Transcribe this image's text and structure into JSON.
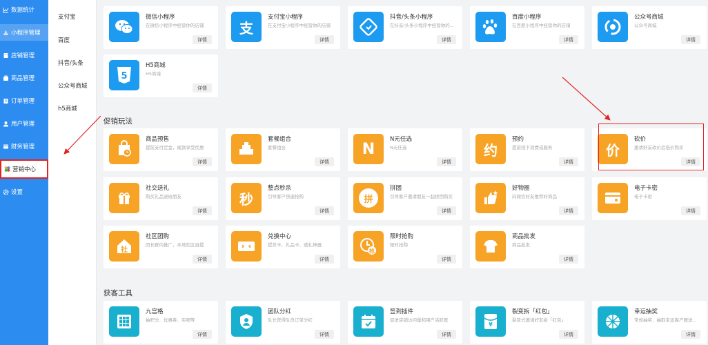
{
  "sidebar": {
    "items": [
      {
        "label": "数据统计",
        "icon": "chart-icon"
      },
      {
        "label": "小程序管理",
        "icon": "link-icon"
      },
      {
        "label": "店铺管理",
        "icon": "store-icon"
      },
      {
        "label": "商品管理",
        "icon": "goods-icon"
      },
      {
        "label": "订单管理",
        "icon": "order-icon"
      },
      {
        "label": "用户管理",
        "icon": "user-icon"
      },
      {
        "label": "财务管理",
        "icon": "finance-icon"
      },
      {
        "label": "营销中心",
        "icon": "marketing-icon"
      },
      {
        "label": "设置",
        "icon": "gear-icon"
      }
    ]
  },
  "submenu": {
    "items": [
      "支付宝",
      "百度",
      "抖音/头条",
      "公众号商城",
      "h5商城"
    ]
  },
  "sections": {
    "promo": "促销玩法",
    "acquire": "获客工具"
  },
  "button_label": "详情",
  "platform_cards": [
    {
      "title": "微信小程序",
      "desc": "在微信小程序中经营你的店铺",
      "icon": "wechat-icon"
    },
    {
      "title": "支付宝小程序",
      "desc": "在支付宝小程序中经营你的店铺",
      "icon": "alipay-icon",
      "glyph": "支"
    },
    {
      "title": "抖音/头条小程序",
      "desc": "在抖音/头条小程序中经营你的...",
      "icon": "tiktok-icon"
    },
    {
      "title": "百度小程序",
      "desc": "在百度小程序中经营你的店铺",
      "icon": "baidu-icon"
    },
    {
      "title": "公众号商城",
      "desc": "公众号商城",
      "icon": "official-account-icon"
    },
    {
      "title": "H5商城",
      "desc": "H5商城",
      "icon": "html5-icon",
      "glyph": "5"
    }
  ],
  "promo_cards": [
    {
      "title": "商品预售",
      "desc": "提前支付定金，尾款享受优惠",
      "icon": "presale-icon"
    },
    {
      "title": "套餐组合",
      "desc": "套餐组合",
      "icon": "combo-icon"
    },
    {
      "title": "N元任选",
      "desc": "N元任选",
      "icon": "n-yuan-icon",
      "glyph": "N"
    },
    {
      "title": "预约",
      "desc": "提前线下消费或服务",
      "icon": "booking-icon",
      "glyph": "约"
    },
    {
      "title": "砍价",
      "desc": "邀请好友砍价后低价购买",
      "icon": "bargain-icon",
      "glyph": "价"
    },
    {
      "title": "社交送礼",
      "desc": "购买礼品送给朋友",
      "icon": "gift-icon"
    },
    {
      "title": "整点秒杀",
      "desc": "引导客户快速抢购",
      "icon": "flash-sale-icon",
      "glyph": "秒"
    },
    {
      "title": "拼团",
      "desc": "引导客户邀请朋友一起拼团购买",
      "icon": "group-buy-icon",
      "glyph": "拼"
    },
    {
      "title": "好物圈",
      "desc": "向微信好友推荐好商品",
      "icon": "good-items-icon"
    },
    {
      "title": "电子卡密",
      "desc": "电子卡密",
      "icon": "card-icon"
    },
    {
      "title": "社区团购",
      "desc": "团长群内推广，本地社区自提",
      "icon": "community-icon",
      "glyph": "社"
    },
    {
      "title": "兑换中心",
      "desc": "提货卡、礼品卡、透礼神器",
      "icon": "exchange-icon"
    },
    {
      "title": "限时抢购",
      "desc": "限时抢购",
      "icon": "timed-sale-icon",
      "glyph": "抢"
    },
    {
      "title": "商品批发",
      "desc": "商品批发",
      "icon": "wholesale-icon"
    }
  ],
  "acquire_cards": [
    {
      "title": "九宫格",
      "desc": "抽积分、优惠券、实物等",
      "icon": "grid-icon"
    },
    {
      "title": "团队分红",
      "desc": "队长获得队员订单分红",
      "icon": "team-bonus-icon"
    },
    {
      "title": "签到插件",
      "desc": "促进店铺访问量和用户活跃度",
      "icon": "checkin-icon"
    },
    {
      "title": "裂变拆「红包」",
      "desc": "裂变式邀请好友拆「红包」",
      "icon": "red-packet-icon"
    },
    {
      "title": "幸运抽奖",
      "desc": "常规抽奖，抽取幸运客户赠送...",
      "icon": "lucky-draw-icon"
    }
  ],
  "colors": {
    "sidebar": "#2d8cf0",
    "platform_icon": "#1d9bf0",
    "promo_icon": "#f7a325",
    "acquire_icon": "#19b0cf",
    "annotation": "#e02424"
  }
}
